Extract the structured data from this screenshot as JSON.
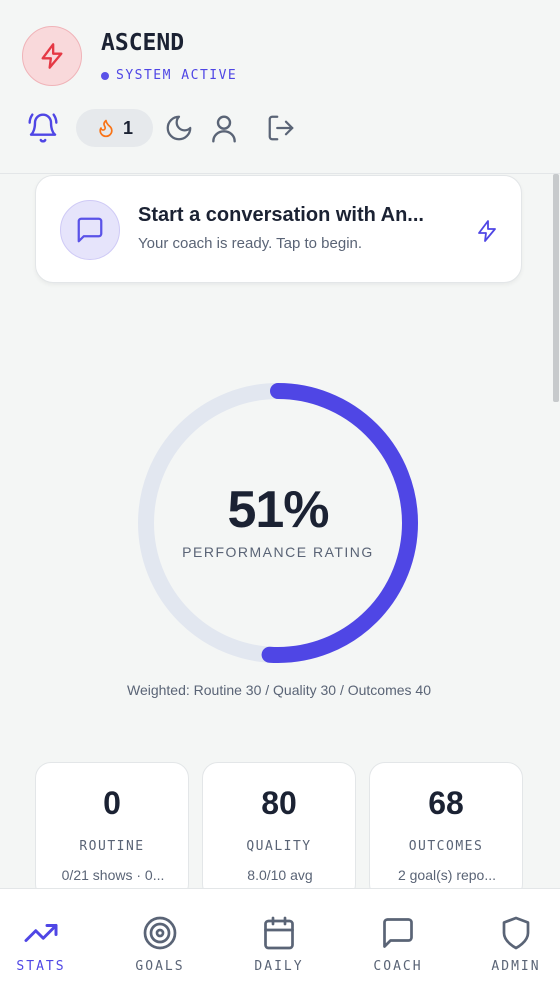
{
  "app": {
    "title": "ASCEND",
    "status": "SYSTEM ACTIVE"
  },
  "header": {
    "streak_count": "1",
    "icons": [
      "bell-icon",
      "flame-icon",
      "moon-icon",
      "user-icon",
      "logout-icon"
    ]
  },
  "coach": {
    "title": "Start a conversation with An...",
    "subtitle": "Your coach is ready. Tap to begin."
  },
  "performance": {
    "value": "51%",
    "percent": 51,
    "label": "PERFORMANCE RATING",
    "weights": "Weighted: Routine 30 / Quality 30 / Outcomes 40"
  },
  "stats": [
    {
      "value": "0",
      "label": "ROUTINE",
      "detail": "0/21 shows · 0..."
    },
    {
      "value": "80",
      "label": "QUALITY",
      "detail": "8.0/10 avg"
    },
    {
      "value": "68",
      "label": "OUTCOMES",
      "detail": "2 goal(s) repo..."
    }
  ],
  "nav": [
    {
      "label": "STATS",
      "icon": "trending-up-icon",
      "active": true
    },
    {
      "label": "GOALS",
      "icon": "target-icon",
      "active": false
    },
    {
      "label": "DAILY",
      "icon": "calendar-icon",
      "active": false
    },
    {
      "label": "COACH",
      "icon": "chat-icon",
      "active": false
    },
    {
      "label": "ADMIN",
      "icon": "shield-icon",
      "active": false
    }
  ],
  "colors": {
    "accent": "#4f46e5",
    "brand_red": "#e53945",
    "track": "#e2e7f0",
    "flame": "#f97316"
  }
}
